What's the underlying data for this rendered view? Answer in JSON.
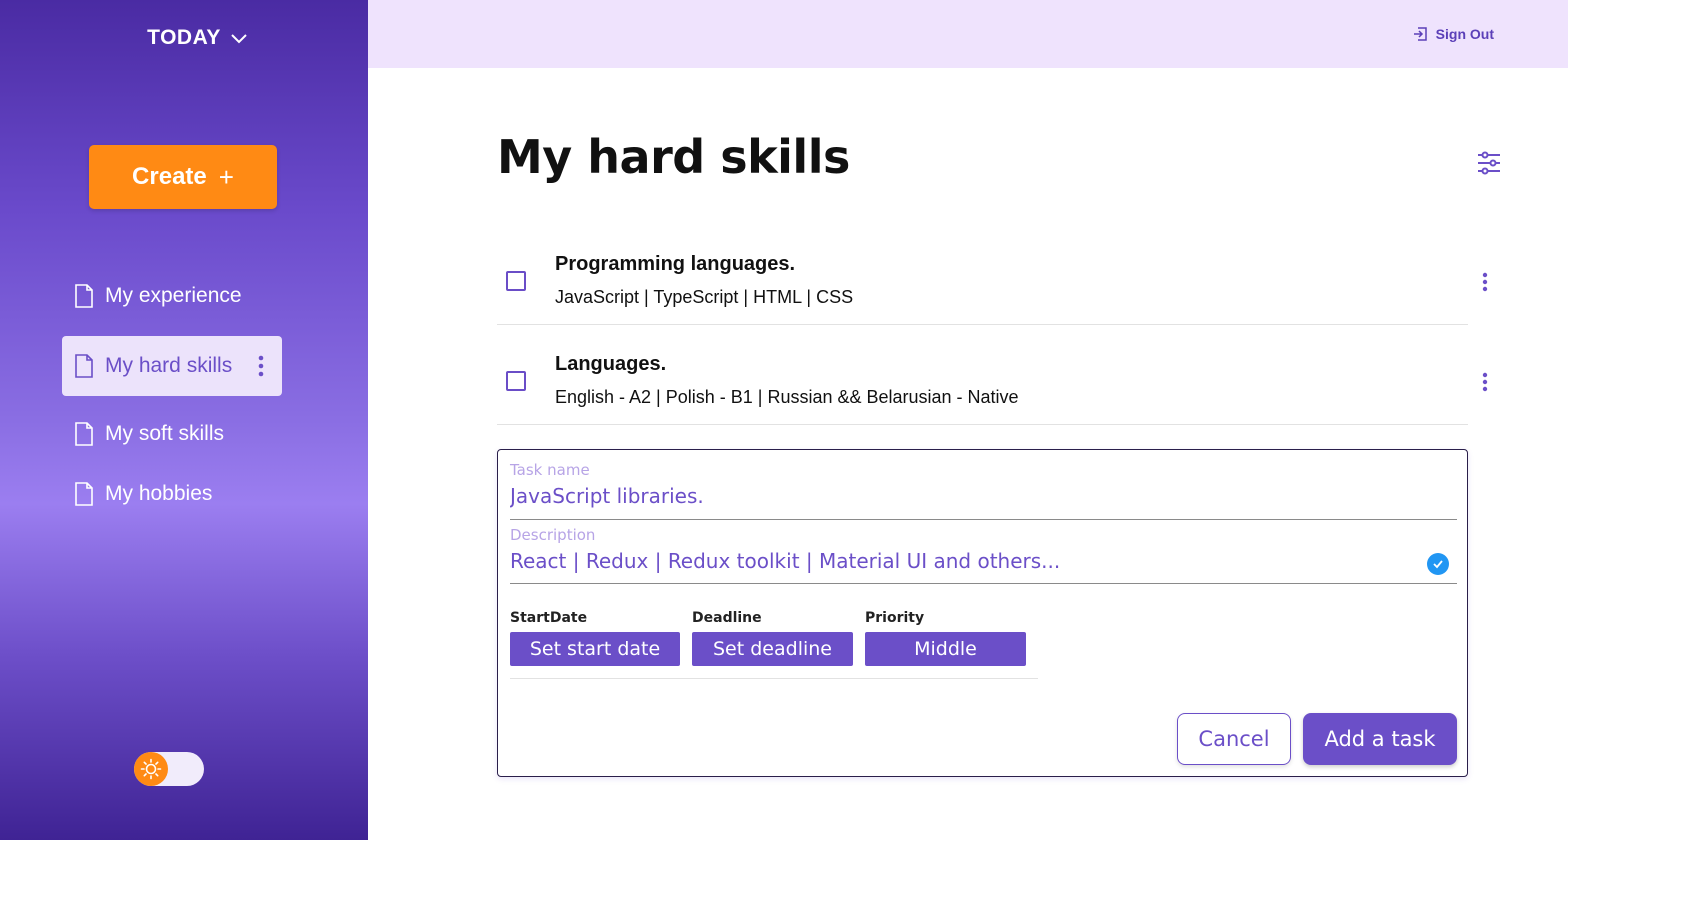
{
  "sidebar": {
    "date_label": "TODAY",
    "create_label": "Create",
    "create_icon": "plus",
    "items": [
      {
        "label": "My experience",
        "icon": "document-icon"
      },
      {
        "label": "My hard skills",
        "icon": "document-icon",
        "active": true
      },
      {
        "label": "My soft skills",
        "icon": "document-icon"
      },
      {
        "label": "My hobbies",
        "icon": "document-icon"
      }
    ],
    "theme_toggle": {
      "icon": "sun-icon",
      "state": "light"
    }
  },
  "header": {
    "sign_out_label": "Sign Out",
    "sign_out_icon": "sign-out-icon"
  },
  "main": {
    "title": "My hard skills",
    "tasks": [
      {
        "name": "Programming languages.",
        "description": "JavaScript | TypeScript | HTML | CSS",
        "done": false
      },
      {
        "name": "Languages.",
        "description": "English - A2 | Polish - B1 | Russian && Belarusian - Native",
        "done": false
      }
    ],
    "form": {
      "task_name_label": "Task name",
      "task_name_value": "JavaScript libraries.",
      "description_label": "Description",
      "description_value": "React | Redux | Redux toolkit | Material UI and others...",
      "start_date_label": "StartDate",
      "start_date_button": "Set start date",
      "deadline_label": "Deadline",
      "deadline_button": "Set deadline",
      "priority_label": "Priority",
      "priority_value": "Middle",
      "cancel_label": "Cancel",
      "add_label": "Add a task"
    }
  },
  "colors": {
    "accent": "#6b4fc8",
    "create_button": "#ff8a14",
    "header_bg": "#efe3fd",
    "check": "#2196f3"
  }
}
